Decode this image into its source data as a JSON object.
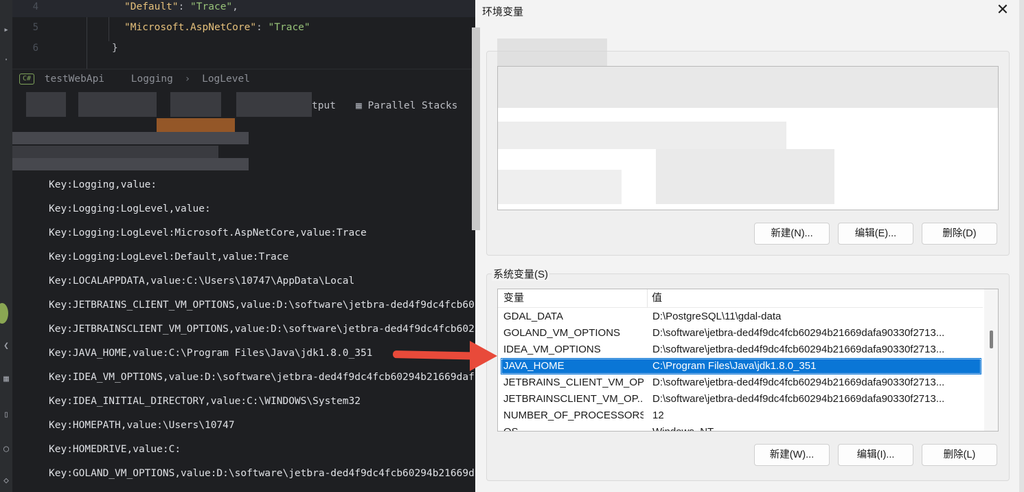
{
  "editor": {
    "lines": [
      {
        "num": "4",
        "key": "\"Default\"",
        "colon": ": ",
        "value": "\"Trace\"",
        "tail": ","
      },
      {
        "num": "5",
        "key": "\"Microsoft.AspNetCore\"",
        "colon": ": ",
        "value": "\"Trace\"",
        "tail": ""
      },
      {
        "num": "6",
        "brace": "}"
      }
    ]
  },
  "breadcrumb": {
    "lang_badge": "C#",
    "project": "testWebApi",
    "items": [
      "Logging",
      "LogLevel"
    ],
    "separator": "›"
  },
  "toolwindow": {
    "output_tab_partial": "tput",
    "parallel_stacks_label": "Parallel Stacks"
  },
  "console": {
    "lines": [
      "Key:Logging,value:",
      "Key:Logging:LogLevel,value:",
      "Key:Logging:LogLevel:Microsoft.AspNetCore,value:Trace",
      "Key:Logging:LogLevel:Default,value:Trace",
      "Key:LOCALAPPDATA,value:C:\\Users\\10747\\AppData\\Local",
      "Key:JETBRAINS_CLIENT_VM_OPTIONS,value:D:\\software\\jetbra-ded4f9dc4fcb60",
      "Key:JETBRAINSCLIENT_VM_OPTIONS,value:D:\\software\\jetbra-ded4f9dc4fcb602",
      "Key:JAVA_HOME,value:C:\\Program Files\\Java\\jdk1.8.0_351",
      "Key:IDEA_VM_OPTIONS,value:D:\\software\\jetbra-ded4f9dc4fcb60294b21669daf",
      "Key:IDEA_INITIAL_DIRECTORY,value:C:\\WINDOWS\\System32",
      "Key:HOMEPATH,value:\\Users\\10747",
      "Key:HOMEDRIVE,value:C:",
      "Key:GOLAND_VM_OPTIONS,value:D:\\software\\jetbra-ded4f9dc4fcb60294b21669d"
    ]
  },
  "dialog": {
    "title": "环境变量",
    "close_icon": "close-icon",
    "user_buttons": {
      "new": "新建(N)...",
      "edit": "编辑(E)...",
      "delete": "删除(D)"
    },
    "system_group_label": "系统变量(S)",
    "columns": {
      "name": "变量",
      "value": "值"
    },
    "system_vars": [
      {
        "name": "GDAL_DATA",
        "value": "D:\\PostgreSQL\\11\\gdal-data"
      },
      {
        "name": "GOLAND_VM_OPTIONS",
        "value": "D:\\software\\jetbra-ded4f9dc4fcb60294b21669dafa90330f2713..."
      },
      {
        "name": "IDEA_VM_OPTIONS",
        "value": "D:\\software\\jetbra-ded4f9dc4fcb60294b21669dafa90330f2713..."
      },
      {
        "name": "JAVA_HOME",
        "value": "C:\\Program Files\\Java\\jdk1.8.0_351"
      },
      {
        "name": "JETBRAINS_CLIENT_VM_OP...",
        "value": "D:\\software\\jetbra-ded4f9dc4fcb60294b21669dafa90330f2713..."
      },
      {
        "name": "JETBRAINSCLIENT_VM_OP...",
        "value": "D:\\software\\jetbra-ded4f9dc4fcb60294b21669dafa90330f2713..."
      },
      {
        "name": "NUMBER_OF_PROCESSORS",
        "value": "12"
      },
      {
        "name": "OS",
        "value": "Windows_NT"
      }
    ],
    "selected_var": "JAVA_HOME",
    "system_buttons": {
      "new": "新建(W)...",
      "edit": "编辑(I)...",
      "delete": "删除(L)"
    }
  },
  "colors": {
    "selection": "#0a76d6",
    "arrow": "#e84a3a",
    "ide_background": "#1e1f22"
  }
}
